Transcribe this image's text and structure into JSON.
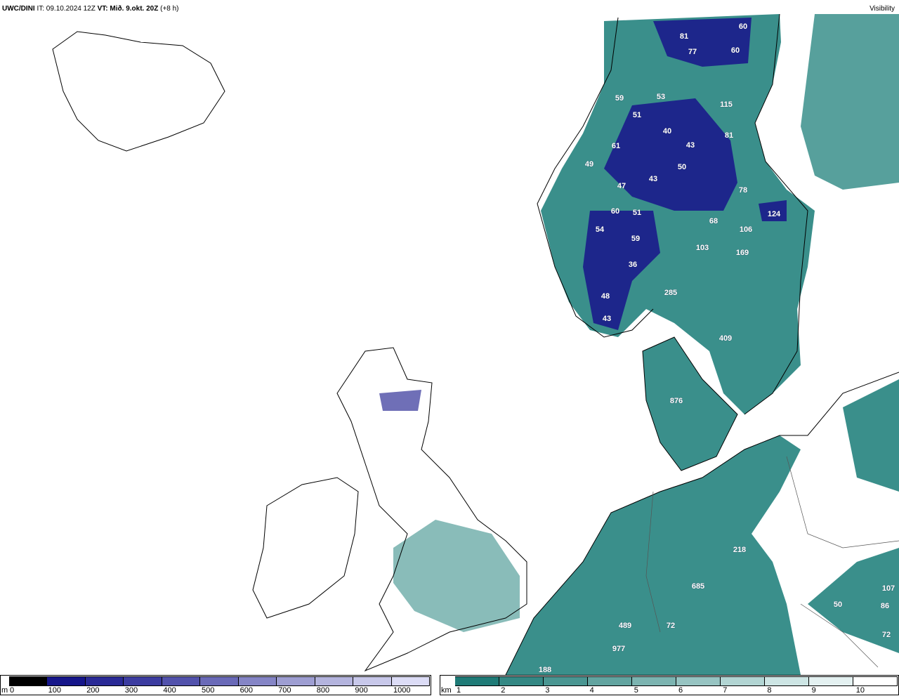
{
  "header": {
    "model": "UWC/DINI",
    "it_label": "IT:",
    "it_value": "09.10.2024 12Z",
    "vt_label": "VT:",
    "vt_value": "Mið. 9.okt. 20Z",
    "lead": "(+8 h)",
    "parameter": "Visibility"
  },
  "map_labels": [
    "60",
    "81",
    "77",
    "60",
    "59",
    "53",
    "51",
    "115",
    "40",
    "81",
    "43",
    "61",
    "50",
    "49",
    "43",
    "47",
    "78",
    "60",
    "51",
    "124",
    "68",
    "106",
    "54",
    "59",
    "103",
    "169",
    "36",
    "285",
    "48",
    "43",
    "409",
    "876",
    "218",
    "685",
    "489",
    "72",
    "977",
    "188",
    "107",
    "86",
    "72",
    "50"
  ],
  "legend_m": {
    "unit": "m",
    "ticks": [
      "0",
      "100",
      "200",
      "300",
      "400",
      "500",
      "600",
      "700",
      "800",
      "900",
      "1000"
    ],
    "colors": [
      "#000000",
      "#16168a",
      "#2a2a96",
      "#3c3ca0",
      "#5252ac",
      "#6a6ab8",
      "#8585c6",
      "#9e9ed2",
      "#b4b4de",
      "#c8c8ea",
      "#dcdcf6"
    ]
  },
  "legend_km": {
    "unit": "km",
    "ticks": [
      "1",
      "2",
      "3",
      "4",
      "5",
      "6",
      "7",
      "8",
      "9",
      "10"
    ],
    "colors": [
      "#1f7b77",
      "#348884",
      "#4a9692",
      "#62a4a0",
      "#7cb4b1",
      "#97c4c2",
      "#b2d5d3",
      "#cde5e4",
      "#e4f1f1",
      "#ffffff"
    ]
  },
  "colors": {
    "fog_dense": "#1a1a8c",
    "fog_teal": "#3a8f8b",
    "coast": "#000000"
  }
}
